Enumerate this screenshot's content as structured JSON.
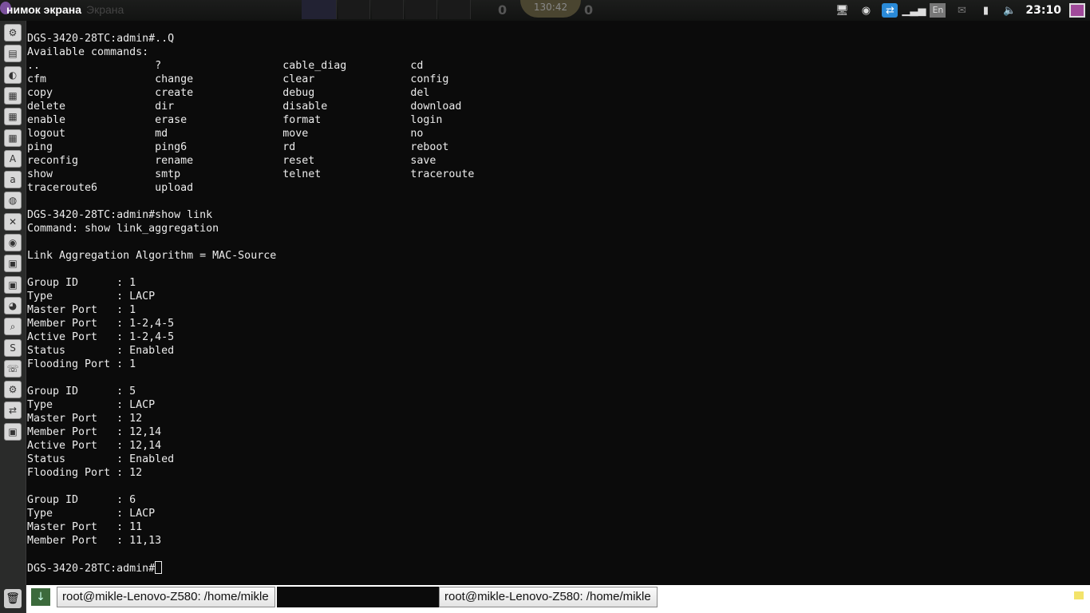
{
  "topbar": {
    "title": "нимок экрана",
    "ghost_title": "Экрана",
    "timer": "130:42",
    "score_left": "0",
    "score_right": "0",
    "clock": "23:10",
    "keyboard_layout": "En"
  },
  "launcher": {
    "icons": [
      "system-settings-icon",
      "files-icon",
      "camera-icon",
      "document-icon",
      "spreadsheet-icon",
      "presentation-icon",
      "software-center-icon",
      "amazon-icon",
      "browser-icon",
      "tools-icon",
      "chrome-icon",
      "app-icon",
      "app-icon-2",
      "thunderbird-icon",
      "screenshot-icon",
      "skype-icon",
      "viber-icon",
      "steam-icon",
      "teamviewer-icon",
      "camera-app-icon"
    ],
    "trash_label": "trash"
  },
  "terminal": {
    "lines": [
      "DGS-3420-28TC:admin#..Q",
      "Available commands:",
      "..                  ?                   cable_diag          cd",
      "cfm                 change              clear               config",
      "copy                create              debug               del",
      "delete              dir                 disable             download",
      "enable              erase               format              login",
      "logout              md                  move                no",
      "ping                ping6               rd                  reboot",
      "reconfig            rename              reset               save",
      "show                smtp                telnet              traceroute",
      "traceroute6         upload",
      "",
      "DGS-3420-28TC:admin#show link",
      "Command: show link_aggregation",
      "",
      "Link Aggregation Algorithm = MAC-Source",
      "",
      "Group ID      : 1",
      "Type          : LACP",
      "Master Port   : 1",
      "Member Port   : 1-2,4-5",
      "Active Port   : 1-2,4-5",
      "Status        : Enabled",
      "Flooding Port : 1",
      "",
      "Group ID      : 5",
      "Type          : LACP",
      "Master Port   : 12",
      "Member Port   : 12,14",
      "Active Port   : 12,14",
      "Status        : Enabled",
      "Flooding Port : 12",
      "",
      "Group ID      : 6",
      "Type          : LACP",
      "Master Port   : 11",
      "Member Port   : 11,13",
      ""
    ],
    "prompt": "DGS-3420-28TC:admin#"
  },
  "taskbar": {
    "windows": [
      "root@mikle-Lenovo-Z580: /home/mikle",
      "root@mikle-Lenovo-Z580: /home/mikle"
    ]
  }
}
